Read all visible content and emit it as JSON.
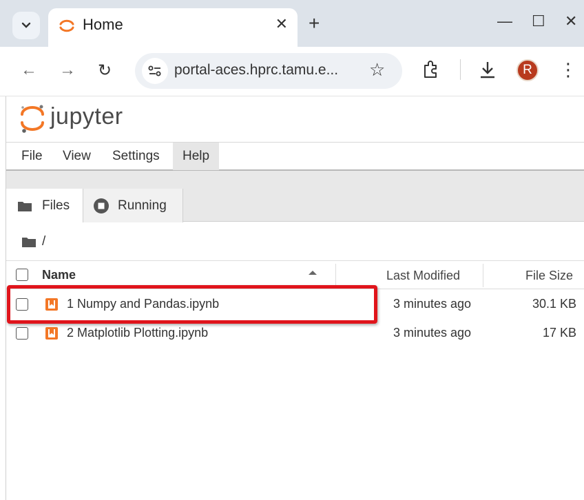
{
  "browser": {
    "tab_title": "Home",
    "url": "portal-aces.hprc.tamu.e...",
    "avatar_letter": "R",
    "avatar_color": "#b83a1e"
  },
  "jupyter": {
    "wordmark": "jupyter",
    "menu": [
      "File",
      "View",
      "Settings",
      "Help"
    ],
    "sidebar_tabs": [
      "Files",
      "Running"
    ],
    "breadcrumb": "/",
    "columns": {
      "name": "Name",
      "modified": "Last Modified",
      "size": "File Size"
    },
    "files": [
      {
        "name": "1 Numpy and Pandas.ipynb",
        "modified": "3 minutes ago",
        "size": "30.1 KB",
        "highlighted": true
      },
      {
        "name": "2 Matplotlib Plotting.ipynb",
        "modified": "3 minutes ago",
        "size": "17 KB",
        "highlighted": false
      }
    ],
    "accent_color": "#f37726",
    "highlight_color": "#e0141b"
  }
}
